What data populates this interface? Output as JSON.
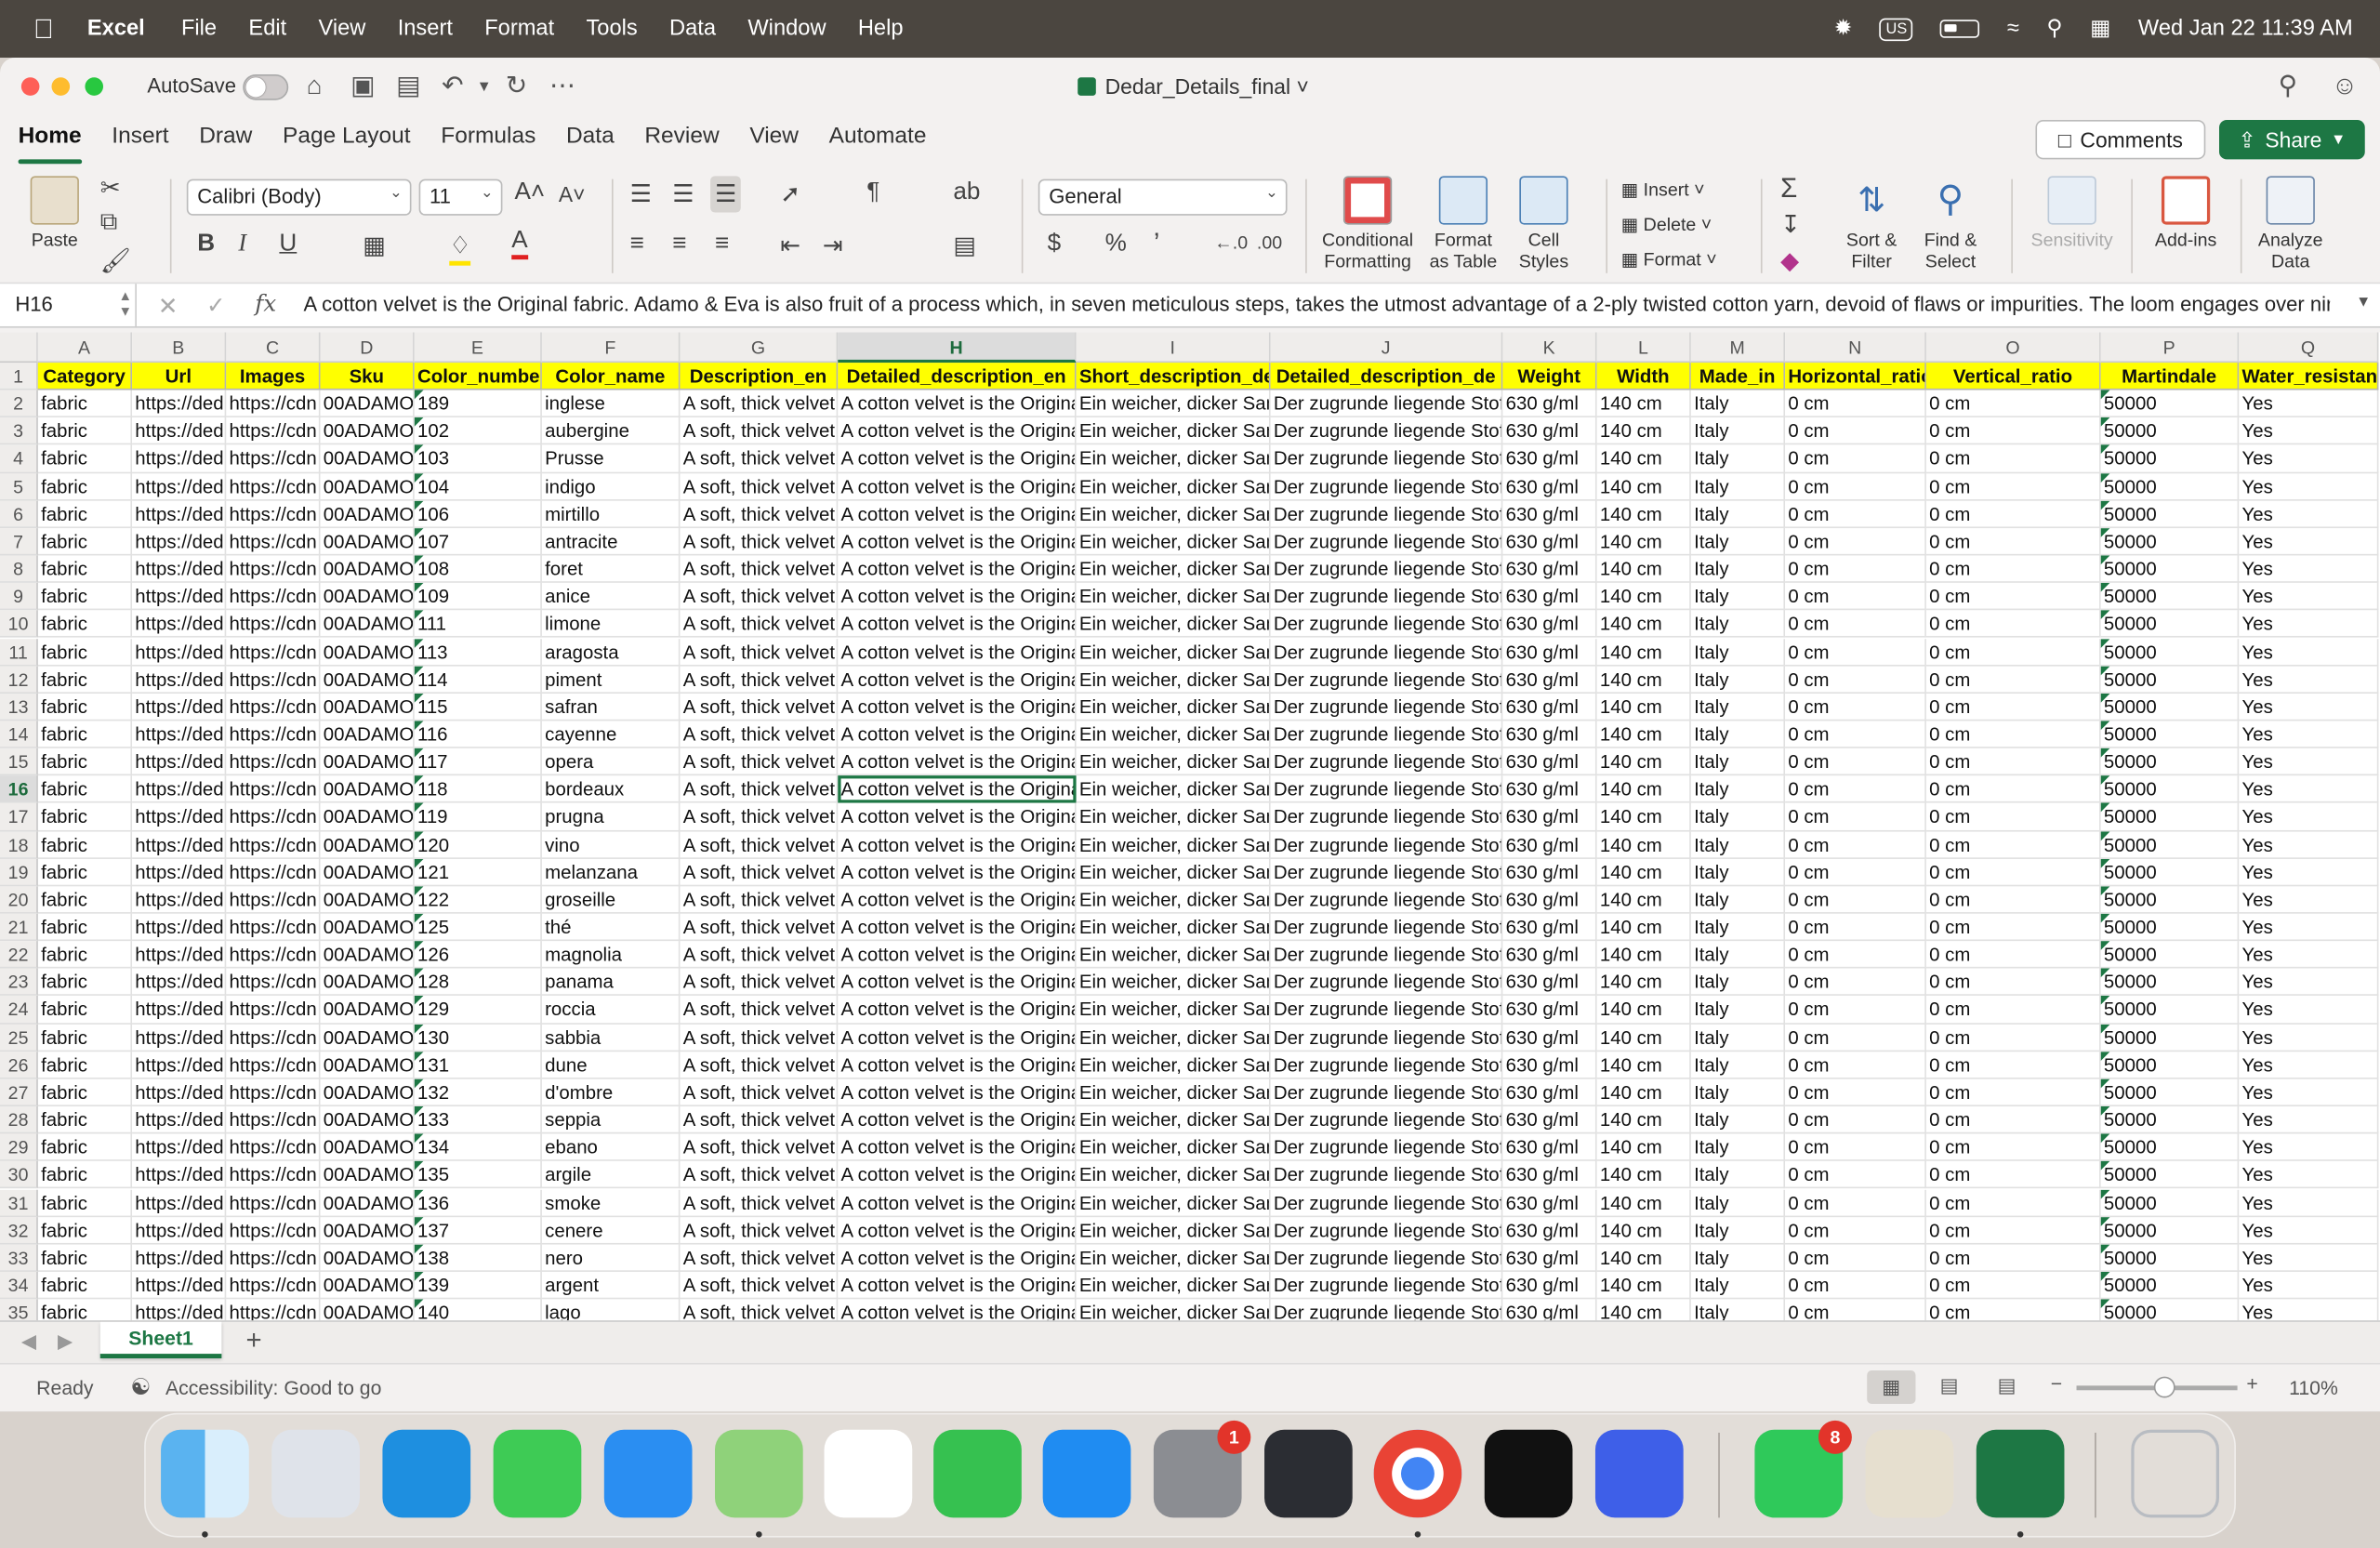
{
  "menubar": {
    "app": "Excel",
    "items": [
      "File",
      "Edit",
      "View",
      "Insert",
      "Format",
      "Tools",
      "Data",
      "Window",
      "Help"
    ],
    "keyboard": "US",
    "datetime": "Wed Jan 22  11:39 AM"
  },
  "titlebar": {
    "autosave_label": "AutoSave",
    "doc_title": "Dedar_Details_final"
  },
  "ribbon_tabs": [
    "Home",
    "Insert",
    "Draw",
    "Page Layout",
    "Formulas",
    "Data",
    "Review",
    "View",
    "Automate"
  ],
  "ribbon_buttons": {
    "comments": "Comments",
    "share": "Share",
    "paste": "Paste",
    "font_name": "Calibri (Body)",
    "font_size": "11",
    "number_format": "General",
    "conditional_formatting": "Conditional Formatting",
    "format_as_table": "Format as Table",
    "cell_styles": "Cell Styles",
    "insert": "Insert",
    "delete": "Delete",
    "format": "Format",
    "sort_filter": "Sort & Filter",
    "find_select": "Find & Select",
    "sensitivity": "Sensitivity",
    "add_ins": "Add-ins",
    "analyze_data": "Analyze Data"
  },
  "formula_bar": {
    "name_box": "H16",
    "formula": "A cotton velvet is the Original fabric. Adamo & Eva is also fruit of a process which, in seven meticulous steps, takes the utmost advantage of a 2-ply twisted cotton yarn, devoid of flaws or impurities. The loom engages over nine"
  },
  "columns": [
    {
      "letter": "A",
      "header": "Category"
    },
    {
      "letter": "B",
      "header": "Url"
    },
    {
      "letter": "C",
      "header": "Images"
    },
    {
      "letter": "D",
      "header": "Sku"
    },
    {
      "letter": "E",
      "header": "Color_number"
    },
    {
      "letter": "F",
      "header": "Color_name"
    },
    {
      "letter": "G",
      "header": "Description_en"
    },
    {
      "letter": "H",
      "header": "Detailed_description_en"
    },
    {
      "letter": "I",
      "header": "Short_description_de"
    },
    {
      "letter": "J",
      "header": "Detailed_description_de"
    },
    {
      "letter": "K",
      "header": "Weight"
    },
    {
      "letter": "L",
      "header": "Width"
    },
    {
      "letter": "M",
      "header": "Made_in"
    },
    {
      "letter": "N",
      "header": "Horizontal_ratio"
    },
    {
      "letter": "O",
      "header": "Vertical_ratio"
    },
    {
      "letter": "P",
      "header": "Martindale"
    },
    {
      "letter": "Q",
      "header": "Water_resistanc"
    }
  ],
  "common": {
    "category": "fabric",
    "url": "https://ded",
    "images": "https://cdn",
    "sku": "00ADAMO_",
    "desc_en": "A soft, thick velvet (",
    "det_en": "A cotton velvet is the Original",
    "det_en_active": "A cotton velvet is the Origina",
    "short_de": "Ein weicher, dicker Sam",
    "det_de": "Der zugrunde liegende Stoff",
    "weight": "630 g/ml",
    "width": "140 cm",
    "made_in": "Italy",
    "h_ratio": "0 cm",
    "v_ratio": "0 cm",
    "martindale": "50000",
    "water": "Yes"
  },
  "rows": [
    {
      "n": "2",
      "color_number": "189",
      "color_name": "inglese"
    },
    {
      "n": "3",
      "color_number": "102",
      "color_name": "aubergine"
    },
    {
      "n": "4",
      "color_number": "103",
      "color_name": "Prusse"
    },
    {
      "n": "5",
      "color_number": "104",
      "color_name": "indigo"
    },
    {
      "n": "6",
      "color_number": "106",
      "color_name": "mirtillo"
    },
    {
      "n": "7",
      "color_number": "107",
      "color_name": "antracite"
    },
    {
      "n": "8",
      "color_number": "108",
      "color_name": "foret"
    },
    {
      "n": "9",
      "color_number": "109",
      "color_name": "anice"
    },
    {
      "n": "10",
      "color_number": "111",
      "color_name": "limone"
    },
    {
      "n": "11",
      "color_number": "113",
      "color_name": "aragosta"
    },
    {
      "n": "12",
      "color_number": "114",
      "color_name": "piment"
    },
    {
      "n": "13",
      "color_number": "115",
      "color_name": "safran"
    },
    {
      "n": "14",
      "color_number": "116",
      "color_name": "cayenne"
    },
    {
      "n": "15",
      "color_number": "117",
      "color_name": "opera"
    },
    {
      "n": "16",
      "color_number": "118",
      "color_name": "bordeaux"
    },
    {
      "n": "17",
      "color_number": "119",
      "color_name": "prugna"
    },
    {
      "n": "18",
      "color_number": "120",
      "color_name": "vino"
    },
    {
      "n": "19",
      "color_number": "121",
      "color_name": "melanzana"
    },
    {
      "n": "20",
      "color_number": "122",
      "color_name": "groseille"
    },
    {
      "n": "21",
      "color_number": "125",
      "color_name": "thé"
    },
    {
      "n": "22",
      "color_number": "126",
      "color_name": "magnolia"
    },
    {
      "n": "23",
      "color_number": "128",
      "color_name": "panama"
    },
    {
      "n": "24",
      "color_number": "129",
      "color_name": "roccia"
    },
    {
      "n": "25",
      "color_number": "130",
      "color_name": "sabbia"
    },
    {
      "n": "26",
      "color_number": "131",
      "color_name": "dune"
    },
    {
      "n": "27",
      "color_number": "132",
      "color_name": "d'ombre"
    },
    {
      "n": "28",
      "color_number": "133",
      "color_name": "seppia"
    },
    {
      "n": "29",
      "color_number": "134",
      "color_name": "ebano"
    },
    {
      "n": "30",
      "color_number": "135",
      "color_name": "argile"
    },
    {
      "n": "31",
      "color_number": "136",
      "color_name": "smoke"
    },
    {
      "n": "32",
      "color_number": "137",
      "color_name": "cenere"
    },
    {
      "n": "33",
      "color_number": "138",
      "color_name": "nero"
    },
    {
      "n": "34",
      "color_number": "139",
      "color_name": "argent"
    },
    {
      "n": "35",
      "color_number": "140",
      "color_name": "lago"
    }
  ],
  "active_row": "16",
  "active_col": "H",
  "sheet_tab": "Sheet1",
  "status": {
    "ready": "Ready",
    "accessibility": "Accessibility: Good to go",
    "zoom": "110%",
    "zoom_level": 0.55
  },
  "dock": {
    "apps": [
      "finder",
      "launchpad",
      "safari",
      "messages",
      "mail",
      "maps",
      "photos",
      "facetime",
      "app-store",
      "system-settings",
      "iphone-mirroring",
      "chrome",
      "pycharm",
      "nordvpn",
      "whatsapp",
      "python",
      "excel",
      "trash"
    ],
    "badges": {
      "system_settings": "1",
      "whatsapp": "8"
    }
  },
  "colors": {
    "excel_green": "#1d7744",
    "header_yellow": "#ffff00"
  }
}
